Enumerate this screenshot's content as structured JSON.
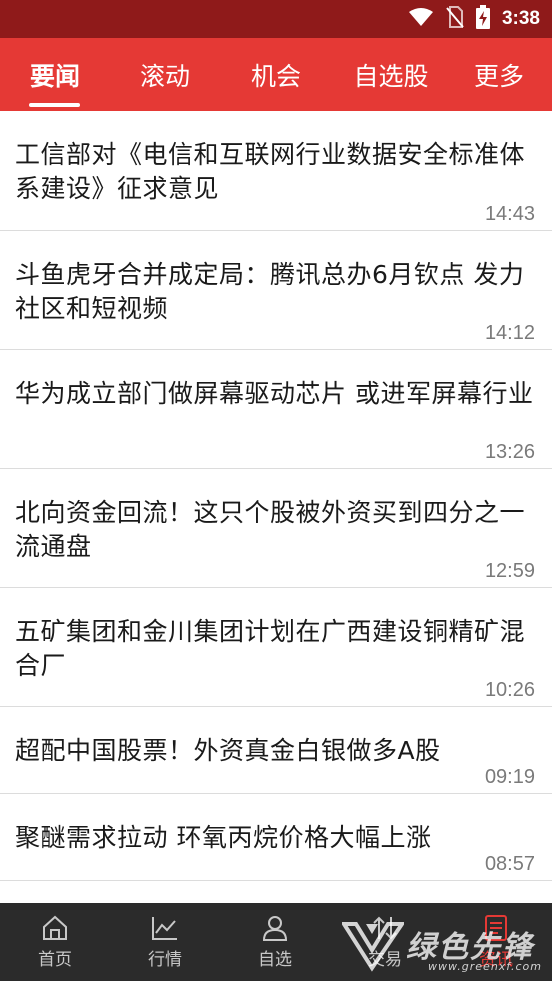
{
  "status_bar": {
    "time": "3:38",
    "icons": [
      "wifi-icon",
      "no-sim-icon",
      "battery-charging-icon"
    ]
  },
  "top_tabs": [
    {
      "label": "要闻",
      "active": true
    },
    {
      "label": "滚动"
    },
    {
      "label": "机会"
    },
    {
      "label": "自选股"
    },
    {
      "label": "更多"
    }
  ],
  "news": [
    {
      "title": "工信部对《电信和互联网行业数据安全标准体系建设》征求意见",
      "time": "14:43"
    },
    {
      "title": "斗鱼虎牙合并成定局：腾讯总办6月钦点 发力社区和短视频",
      "time": "14:12"
    },
    {
      "title": "华为成立部门做屏幕驱动芯片 或进军屏幕行业",
      "time": "13:26"
    },
    {
      "title": "北向资金回流！这只个股被外资买到四分之一流通盘",
      "time": "12:59"
    },
    {
      "title": "五矿集团和金川集团计划在广西建设铜精矿混合厂",
      "time": "10:26"
    },
    {
      "title": "超配中国股票！外资真金白银做多A股",
      "time": "09:19"
    },
    {
      "title": "聚醚需求拉动 环氧丙烷价格大幅上涨",
      "time": "08:57"
    }
  ],
  "bottom_nav": [
    {
      "label": "首页",
      "icon": "home-icon"
    },
    {
      "label": "行情",
      "icon": "chart-icon"
    },
    {
      "label": "自选",
      "icon": "user-icon"
    },
    {
      "label": "交易",
      "icon": "swap-icon"
    },
    {
      "label": "资讯",
      "icon": "document-icon",
      "active": true
    }
  ],
  "watermark": {
    "text": "绿色先锋",
    "url": "www.greenxf.com"
  },
  "colors": {
    "status_bar": "#8f1a1a",
    "accent": "#e53935",
    "bottom_nav": "#2b2b2b"
  }
}
